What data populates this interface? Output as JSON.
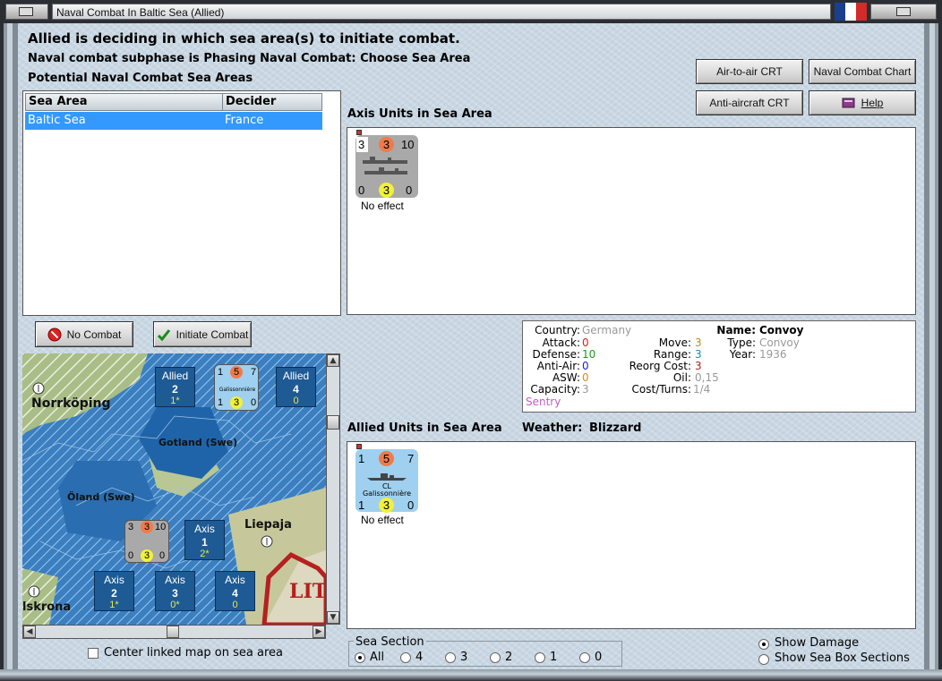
{
  "window": {
    "title": "Naval Combat In Baltic Sea (Allied)"
  },
  "colors": {
    "flag_blue": "#1b3f8f",
    "flag_white": "#ffffff",
    "flag_red": "#d42a2a",
    "selection": "#3399ff"
  },
  "header": {
    "line1": "Allied is deciding in which sea area(s) to initiate combat.",
    "line2": "Naval combat subphase is Phasing Naval Combat: Choose Sea Area",
    "line3": "Potential Naval Combat Sea Areas"
  },
  "buttons": {
    "air_to_air": "Air-to-air CRT",
    "naval_combat_chart": "Naval Combat Chart",
    "anti_aircraft": "Anti-aircraft CRT",
    "help": "Help",
    "no_combat": "No Combat",
    "initiate_combat": "Initiate Combat"
  },
  "sea_table": {
    "columns": [
      "Sea Area",
      "Decider"
    ],
    "rows": [
      {
        "sea_area": "Baltic Sea",
        "decider": "France"
      }
    ]
  },
  "axis_units": {
    "label": "Axis Units in Sea Area",
    "counter": {
      "top_left": "3",
      "top_mid": "3",
      "top_right": "10",
      "bot_left": "0",
      "bot_mid": "3",
      "bot_right": "0",
      "status": "No effect"
    }
  },
  "allied_units": {
    "label": "Allied Units in Sea Area",
    "weather_label": "Weather:",
    "weather_value": "Blizzard",
    "counter": {
      "top_left": "1",
      "top_mid": "5",
      "top_right": "7",
      "class": "CL",
      "name": "Galissonnière",
      "bot_left": "1",
      "bot_mid": "3",
      "bot_right": "0",
      "status": "No effect"
    }
  },
  "info": {
    "country_label": "Country:",
    "country": "Germany",
    "attack_label": "Attack:",
    "attack": "0",
    "defense_label": "Defense:",
    "defense": "10",
    "antiair_label": "Anti-Air:",
    "antiair": "0",
    "asw_label": "ASW:",
    "asw": "0",
    "capacity_label": "Capacity:",
    "capacity": "3",
    "sentry": "Sentry",
    "move_label": "Move:",
    "move": "3",
    "range_label": "Range:",
    "range": "3",
    "reorg_label": "Reorg Cost:",
    "reorg": "3",
    "oil_label": "Oil:",
    "oil": "0,15",
    "cost_label": "Cost/Turns:",
    "cost": "1/4",
    "name_label": "Name:",
    "name": "Convoy",
    "type_label": "Type:",
    "type": "Convoy",
    "year_label": "Year:",
    "year": "1936"
  },
  "map": {
    "places": {
      "norrkoping": "Norrköping",
      "gotland": "Gotland (Swe)",
      "oland": "Öland (Swe)",
      "liepaja": "Liepaja",
      "karlskrona": "lskrona",
      "lit": "LIT"
    },
    "boxes": [
      {
        "title": "Allied",
        "num": "2",
        "sub": "1*"
      },
      {
        "title": "Allied",
        "num": "4",
        "sub": "0"
      },
      {
        "title": "Axis",
        "num": "1",
        "sub": "2*"
      },
      {
        "title": "Axis",
        "num": "2",
        "sub": "1*"
      },
      {
        "title": "Axis",
        "num": "3",
        "sub": "0*"
      },
      {
        "title": "Axis",
        "num": "4",
        "sub": "0"
      }
    ],
    "allied_counter": {
      "a": "1",
      "b": "5",
      "c": "7",
      "d": "1",
      "e": "3",
      "f": "0",
      "name": "Galissonnière"
    },
    "axis_counter": {
      "a": "3",
      "b": "3",
      "c": "10",
      "d": "0",
      "e": "3",
      "f": "0"
    }
  },
  "center_map_label": "Center linked map on sea area",
  "sea_section": {
    "label": "Sea Section",
    "options": [
      "All",
      "4",
      "3",
      "2",
      "1",
      "0"
    ],
    "selected": "All"
  },
  "display_options": {
    "show_damage": "Show Damage",
    "show_sea_box": "Show Sea Box Sections",
    "selected": "Show Damage"
  }
}
